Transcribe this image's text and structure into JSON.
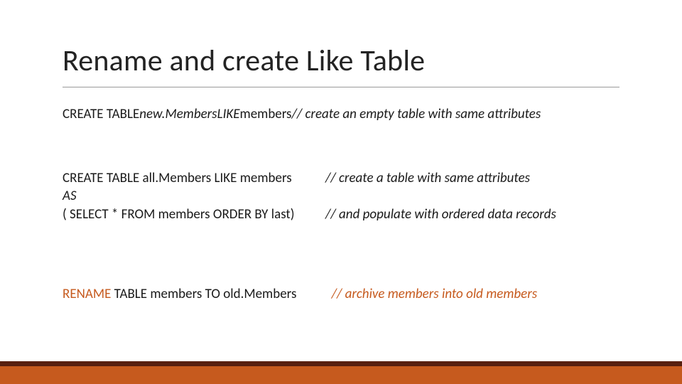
{
  "title": "Rename and create Like Table",
  "line1": {
    "kw": "CREATE TABLE ",
    "ident": "new.Members ",
    "like": "LIKE",
    "rest": " members  ",
    "comment": "// create an empty table with same attributes"
  },
  "line2a": {
    "left": "CREATE TABLE all.Members LIKE members",
    "comment": "// create a table with same attributes"
  },
  "line2b": {
    "as": "AS"
  },
  "line2c": {
    "left": "( SELECT * FROM members ORDER BY last)",
    "comment": "// and populate with ordered data records"
  },
  "line3": {
    "kw": "RENAME",
    "rest": " TABLE members TO old.Members",
    "comment": "// archive members into old members"
  },
  "colors": {
    "accent": "#c65a1e",
    "footer_top": "#571f10"
  }
}
